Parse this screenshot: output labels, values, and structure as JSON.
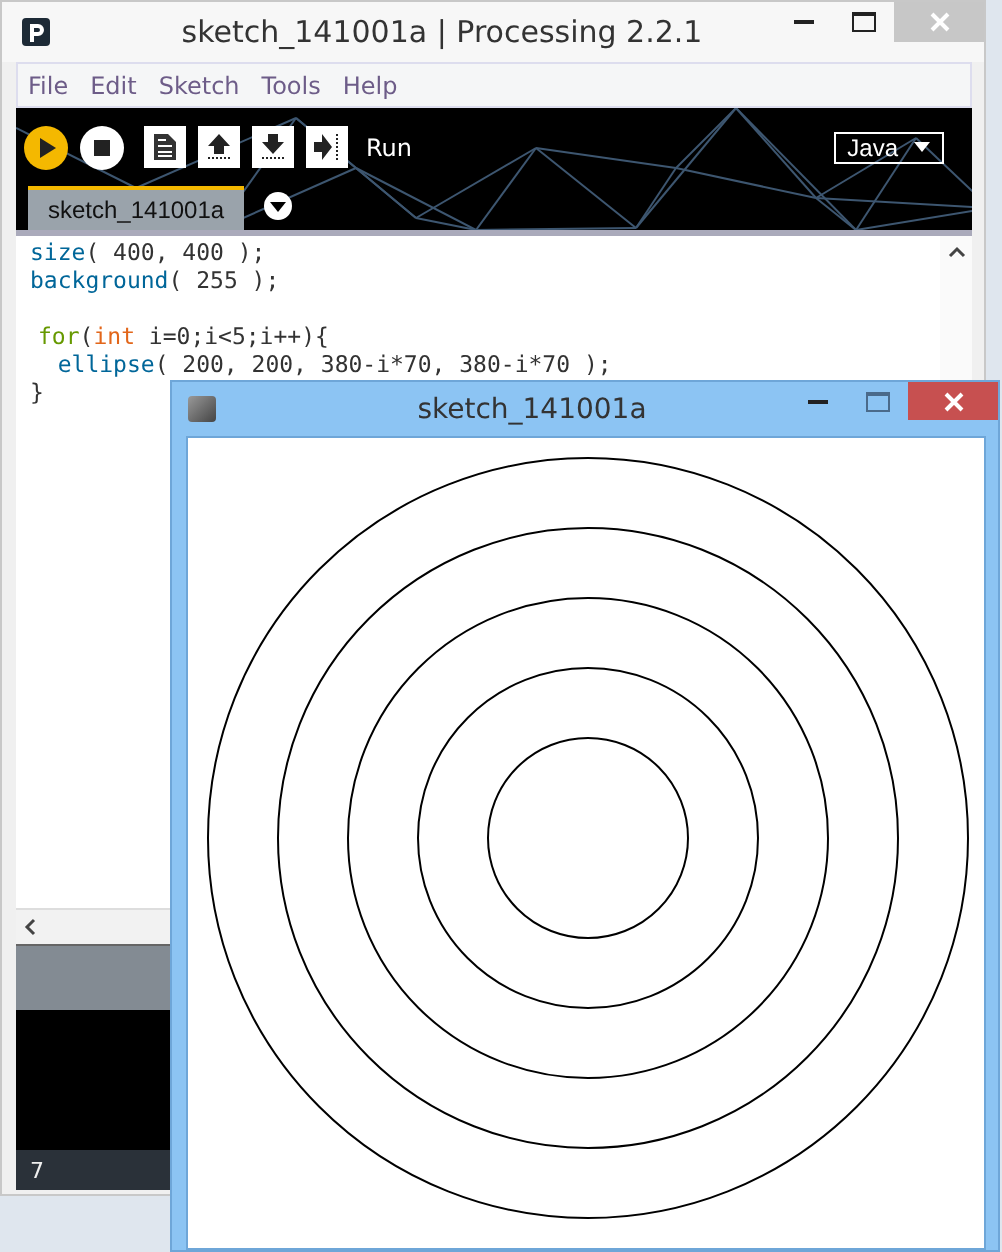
{
  "window": {
    "title": "sketch_141001a | Processing 2.2.1"
  },
  "menu": [
    "File",
    "Edit",
    "Sketch",
    "Tools",
    "Help"
  ],
  "toolbar": {
    "buttons": [
      {
        "kind": "run"
      },
      {
        "kind": "stop"
      },
      {
        "kind": "new"
      },
      {
        "kind": "open"
      },
      {
        "kind": "save"
      },
      {
        "kind": "export"
      }
    ],
    "hint": "Run",
    "mode": "Java"
  },
  "tabs": [
    {
      "label": "sketch_141001a",
      "selected": true
    }
  ],
  "code_blocks": [
    [
      [
        {
          "text": "size",
          "kind": "function"
        },
        {
          "text": "( 400, 400 );",
          "kind": "plain"
        }
      ],
      [
        {
          "text": "background",
          "kind": "function"
        },
        {
          "text": "( 255 );",
          "kind": "plain"
        }
      ]
    ],
    [
      [
        {
          "text": "for",
          "kind": "keyword"
        },
        {
          "text": "(",
          "kind": "plain"
        },
        {
          "text": "int",
          "kind": "type"
        },
        {
          "text": " i=0;i<5;i++){",
          "kind": "plain"
        }
      ],
      [
        {
          "text": "  ellipse",
          "kind": "function"
        },
        {
          "text": "( 200, 200, 380-i*70, 380-i*70 );",
          "kind": "plain"
        }
      ],
      [
        {
          "text": "}",
          "kind": "plain"
        }
      ]
    ]
  ],
  "status": {
    "line": "7"
  },
  "sketch_window": {
    "title": "sketch_141001a"
  }
}
